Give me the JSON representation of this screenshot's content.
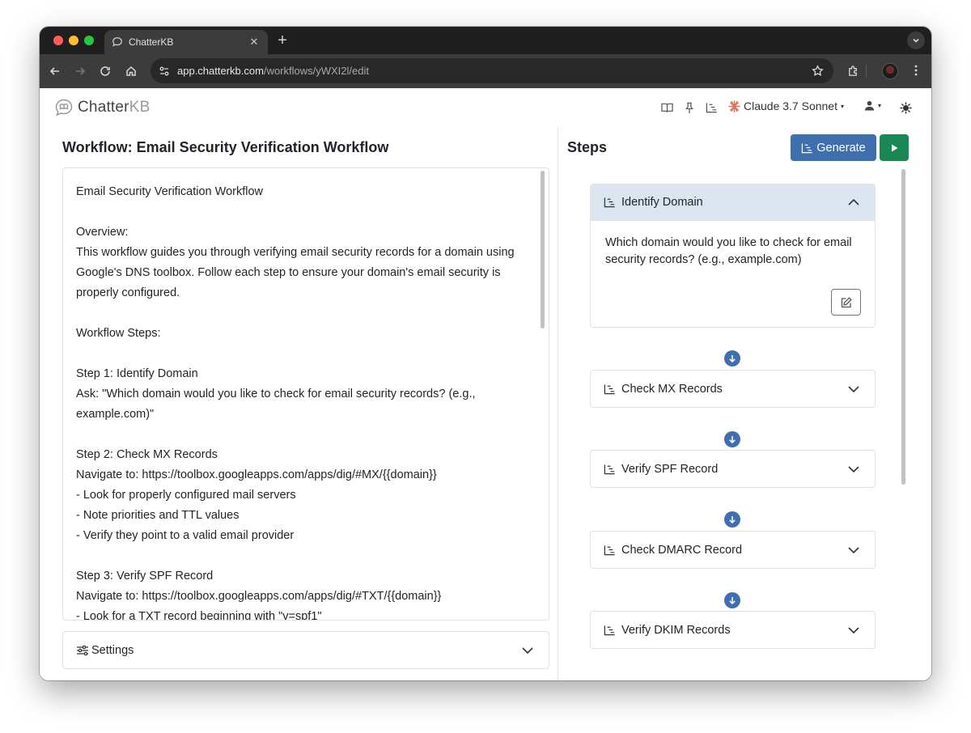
{
  "browser": {
    "tab_title": "ChatterKB",
    "new_tab": "+",
    "close": "✕",
    "url_host": "app.chatterkb.com",
    "url_path": "/workflows/yWXI2l/edit"
  },
  "header": {
    "logo_prefix": "Chatter",
    "logo_suffix": "KB",
    "model_name": "Claude 3.7 Sonnet",
    "caret": "▾"
  },
  "left": {
    "title": "Workflow: Email Security Verification Workflow",
    "editor_text": "Email Security Verification Workflow\n\nOverview:\nThis workflow guides you through verifying email security records for a domain using Google's DNS toolbox. Follow each step to ensure your domain's email security is properly configured.\n\nWorkflow Steps:\n\nStep 1: Identify Domain\nAsk: \"Which domain would you like to check for email security records? (e.g., example.com)\"\n\nStep 2: Check MX Records\nNavigate to: https://toolbox.googleapps.com/apps/dig/#MX/{{domain}}\n- Look for properly configured mail servers\n- Note priorities and TTL values\n- Verify they point to a valid email provider\n\nStep 3: Verify SPF Record\nNavigate to: https://toolbox.googleapps.com/apps/dig/#TXT/{{domain}}\n- Look for a TXT record beginning with \"v=spf1\"",
    "settings_label": "Settings"
  },
  "right": {
    "title": "Steps",
    "generate_label": "Generate",
    "steps": [
      {
        "title": "Identify Domain",
        "body": "Which domain would you like to check for email security records? (e.g., example.com)"
      },
      {
        "title": "Check MX Records"
      },
      {
        "title": "Verify SPF Record"
      },
      {
        "title": "Check DMARC Record"
      },
      {
        "title": "Verify DKIM Records"
      }
    ]
  },
  "colors": {
    "primary": "#3f6fae",
    "success": "#198754",
    "step_open_bg": "#dbe5f0",
    "accent_claude": "#d97757"
  },
  "icons": [
    "chat-bubble-icon",
    "back-arrow-icon",
    "forward-arrow-icon",
    "reload-icon",
    "home-icon",
    "site-settings-icon",
    "bookmark-star-icon",
    "extensions-icon",
    "kebab-menu-icon",
    "book-icon",
    "pin-icon",
    "workflow-list-icon",
    "claude-spark-icon",
    "user-icon",
    "sun-icon",
    "sliders-icon",
    "chevron-down-icon",
    "chevron-up-icon",
    "edit-icon",
    "play-icon",
    "arrow-down-icon"
  ]
}
